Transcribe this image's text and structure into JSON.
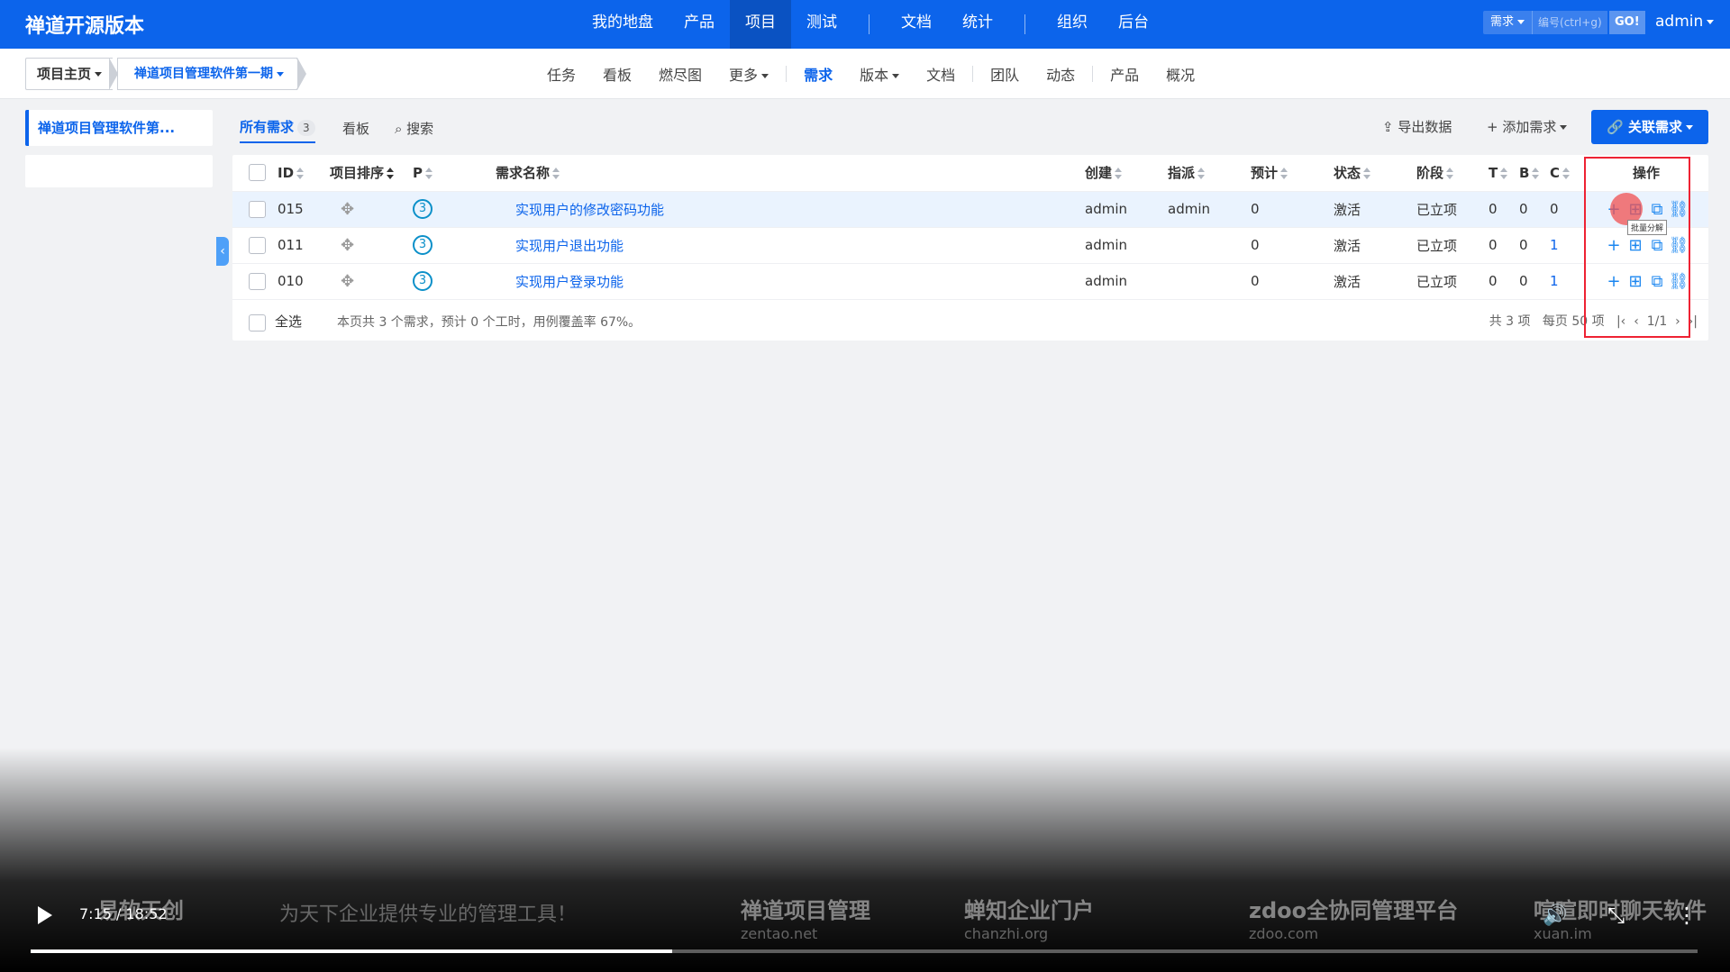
{
  "topnav": {
    "brand": "禅道开源版本",
    "items": [
      "我的地盘",
      "产品",
      "项目",
      "测试",
      "文档",
      "统计",
      "组织",
      "后台"
    ],
    "active": "项目",
    "search_type": "需求",
    "search_placeholder": "编号(ctrl+g)",
    "go": "GO!",
    "user": "admin"
  },
  "subnav": {
    "crumb_home": "项目主页",
    "crumb_project": "禅道项目管理软件第一期",
    "menu": [
      "任务",
      "看板",
      "燃尽图",
      "更多",
      "需求",
      "版本",
      "文档",
      "团队",
      "动态",
      "产品",
      "概况"
    ],
    "active": "需求"
  },
  "sidebar": {
    "project": "禅道项目管理软件第..."
  },
  "toolbar": {
    "tab_all": "所有需求",
    "tab_all_count": "3",
    "tab_kanban": "看板",
    "search": "搜索",
    "export": "导出数据",
    "add": "添加需求",
    "link": "关联需求"
  },
  "table": {
    "headers": [
      "ID",
      "项目排序",
      "P",
      "需求名称",
      "创建",
      "指派",
      "预计",
      "状态",
      "阶段",
      "T",
      "B",
      "C",
      "操作"
    ],
    "rows": [
      {
        "id": "015",
        "pri": "3",
        "title": "实现用户的修改密码功能",
        "creator": "admin",
        "assign": "admin",
        "estimate": "0",
        "status": "激活",
        "stage": "已立项",
        "t": "0",
        "b": "0",
        "c": "0"
      },
      {
        "id": "011",
        "pri": "3",
        "title": "实现用户退出功能",
        "creator": "admin",
        "assign": "",
        "estimate": "0",
        "status": "激活",
        "stage": "已立项",
        "t": "0",
        "b": "0",
        "c": "1"
      },
      {
        "id": "010",
        "pri": "3",
        "title": "实现用户登录功能",
        "creator": "admin",
        "assign": "",
        "estimate": "0",
        "status": "激活",
        "stage": "已立项",
        "t": "0",
        "b": "0",
        "c": "1"
      }
    ],
    "select_all": "全选",
    "summary": "本页共 3 个需求，预计 0 个工时，用例覆盖率 67%。",
    "total": "共 3 项",
    "per_page": "每页 50 项",
    "page": "1/1",
    "tooltip": "批量分解"
  },
  "video": {
    "time": "7:15 / 18:52",
    "progress": 0.385,
    "ads": [
      {
        "name": "易软天创",
        "sub": "为天下企业提供专业的管理工具！"
      },
      {
        "name": "禅道项目管理",
        "sub": "zentao.net"
      },
      {
        "name": "蝉知企业门户",
        "sub": "chanzhi.org"
      },
      {
        "name": "zdoo全协同管理平台",
        "sub": "zdoo.com"
      },
      {
        "name": "喧喧即时聊天软件",
        "sub": "xuan.im"
      }
    ]
  },
  "colors": {
    "primary": "#0c64eb",
    "highlight": "#e23"
  }
}
